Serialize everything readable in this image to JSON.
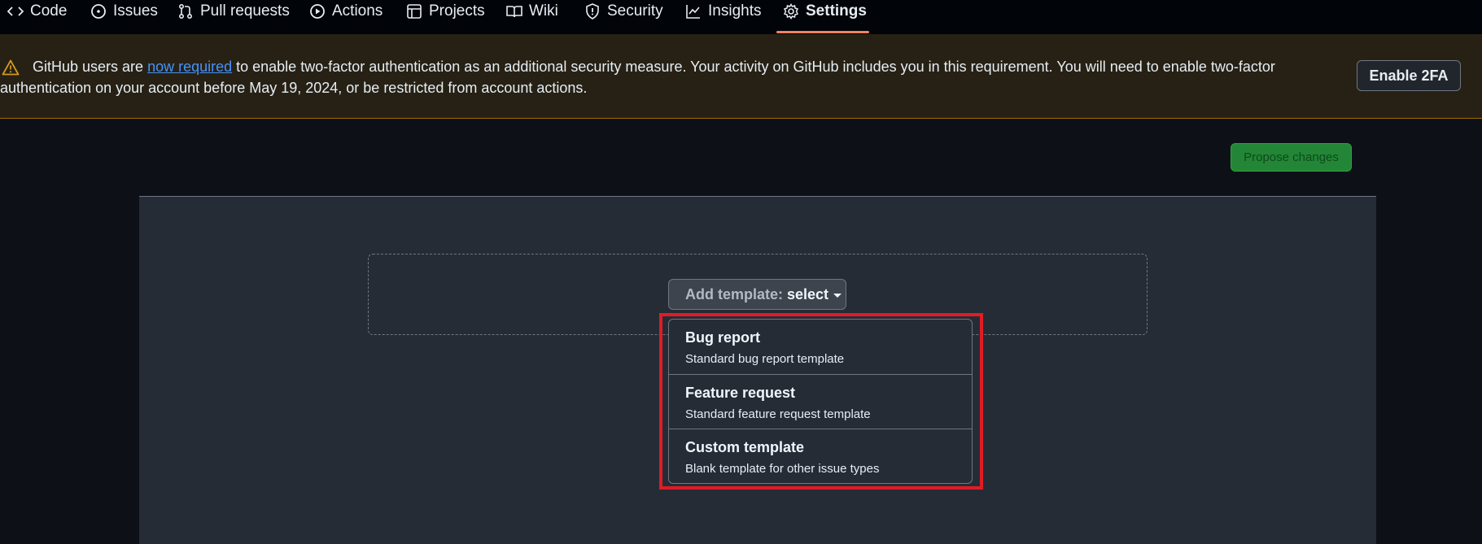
{
  "nav": {
    "tabs": [
      {
        "label": "Code",
        "icon": "code-icon"
      },
      {
        "label": "Issues",
        "icon": "issue-opened-icon"
      },
      {
        "label": "Pull requests",
        "icon": "git-pull-request-icon"
      },
      {
        "label": "Actions",
        "icon": "play-icon"
      },
      {
        "label": "Projects",
        "icon": "table-icon"
      },
      {
        "label": "Wiki",
        "icon": "book-icon"
      },
      {
        "label": "Security",
        "icon": "shield-icon"
      },
      {
        "label": "Insights",
        "icon": "graph-icon"
      },
      {
        "label": "Settings",
        "icon": "gear-icon"
      }
    ],
    "active_tab": "Settings",
    "active_color": "#f78166"
  },
  "banner": {
    "text_before": "GitHub users are ",
    "link": "now required",
    "text_after": " to enable two-factor authentication as an additional security measure. Your activity on GitHub includes you in this requirement. You will need to enable two-factor authentication on your account before May 19, 2024, or be restricted from account actions.",
    "button": "Enable 2FA",
    "icon": "alert-icon",
    "warning_color": "#d29922"
  },
  "toolbar": {
    "propose_label": "Propose changes",
    "propose_color": "#238636"
  },
  "template_select": {
    "label": "Add template:",
    "value": "select"
  },
  "menu": {
    "items": [
      {
        "title": "Bug report",
        "desc": "Standard bug report template"
      },
      {
        "title": "Feature request",
        "desc": "Standard feature request template"
      },
      {
        "title": "Custom template",
        "desc": "Blank template for other issue types"
      }
    ],
    "highlight_color": "#e11c24"
  }
}
